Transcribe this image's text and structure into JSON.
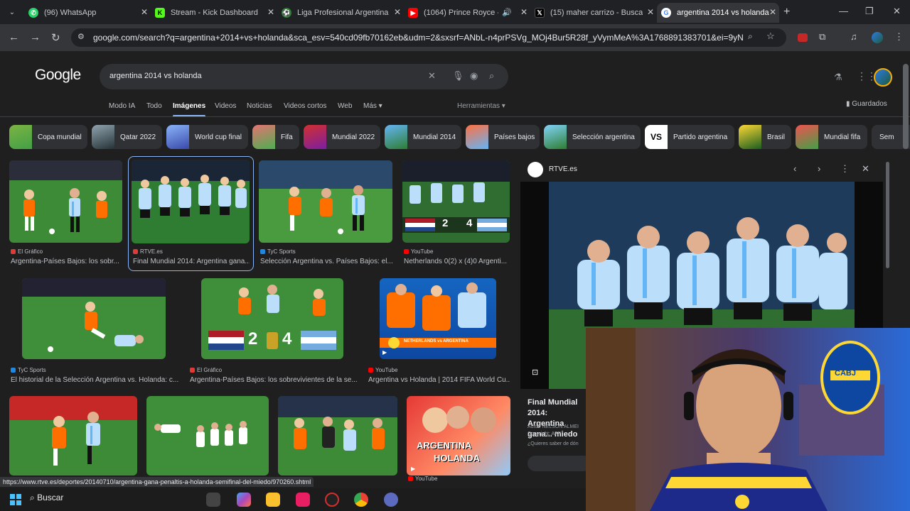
{
  "tabs": [
    {
      "label": "(96) WhatsApp",
      "icon": "whatsapp-icon",
      "color": "#25d366"
    },
    {
      "label": "Stream - Kick Dashboard",
      "icon": "kick-icon",
      "color": "#53fc18"
    },
    {
      "label": "Liga Profesional Argentina",
      "icon": "liga-icon",
      "color": "#4caf50"
    },
    {
      "label": "(1064) Prince Royce -",
      "icon": "youtube-icon",
      "color": "#ff0000"
    },
    {
      "label": "(15) maher carrizo - Busca",
      "icon": "x-icon",
      "color": "#000000"
    },
    {
      "label": "argentina 2014 vs holanda",
      "icon": "google-icon",
      "color": "#ffffff"
    }
  ],
  "address": {
    "url": "google.com/search?q=argentina+2014+vs+holanda&sca_esv=540cd09fb70162eb&udm=2&sxsrf=ANbL-n4prPSVg_MOj4Bur5R28f_yVymMeA%3A1768891383701&ei=9yNac..."
  },
  "google": {
    "logo": "Google",
    "query": "argentina 2014 vs holanda",
    "filters": [
      "Modo IA",
      "Todo",
      "Imágenes",
      "Videos",
      "Noticias",
      "Videos cortos",
      "Web",
      "Más ▾"
    ],
    "tools": "Herramientas ▾",
    "saved": "Guardados"
  },
  "chips": [
    "Copa mundial",
    "Qatar 2022",
    "World cup final",
    "Fifa",
    "Mundial 2022",
    "Mundial 2014",
    "Países bajos",
    "Selección argentina",
    "Partido argentina",
    "Brasil",
    "Mundial fifa",
    "Sem"
  ],
  "results": [
    {
      "source": "El Gráfico",
      "title": "Argentina-Países Bajos: los sobr...",
      "fav": "#e53935"
    },
    {
      "source": "RTVE.es",
      "title": "Final Mundial 2014: Argentina gana...",
      "fav": "#e53935"
    },
    {
      "source": "TyC Sports",
      "title": "Selección Argentina vs. Países Bajos: el...",
      "fav": "#1e88e5"
    },
    {
      "source": "YouTube",
      "title": "Netherlands 0(2) x (4)0 Argenti...",
      "fav": "#ff0000"
    },
    {
      "source": "TyC Sports",
      "title": "El historial de la Selección Argentina vs. Holanda: c...",
      "fav": "#1e88e5"
    },
    {
      "source": "El Gráfico",
      "title": "Argentina-Países Bajos: los sobrevivientes de la se...",
      "fav": "#e53935"
    },
    {
      "source": "YouTube",
      "title": "Argentina vs Holanda | 2014 FIFA World Cu...",
      "fav": "#ff0000"
    },
    {
      "source": "",
      "title": "",
      "fav": "#e53935"
    },
    {
      "source": "",
      "title": "",
      "fav": "#e53935"
    },
    {
      "source": "",
      "title": "",
      "fav": "#e53935"
    },
    {
      "source": "YouTube",
      "title": "",
      "fav": "#ff0000"
    }
  ],
  "thumb_text": {
    "score1": "2",
    "score2": "4",
    "banner": "NETHERLANDS vs ARGENTINA",
    "yt1": "ARGENTINA",
    "yt2": "HOLANDA"
  },
  "panel": {
    "source": "RTVE.es",
    "title": "Final Mundial 2014: Argentina gana... miedo",
    "author": "Autor: NELSON ALMEI",
    "copyright": "Copyright: AFP",
    "more": "¿Quieres saber de dón"
  },
  "status_url": "https://www.rtve.es/deportes/20140710/argentina-gana-penaltis-a-holanda-semifinal-del-miedo/970260.shtml",
  "taskbar": {
    "search": "Buscar"
  },
  "webcam": {
    "jersey_text": "CABJ"
  }
}
